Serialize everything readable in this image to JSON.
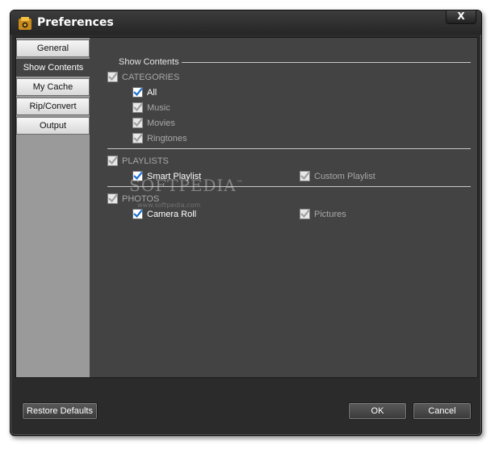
{
  "window": {
    "title": "Preferences",
    "close_label": "X"
  },
  "sidebar": {
    "items": [
      {
        "label": "General",
        "active": false
      },
      {
        "label": "Show Contents",
        "active": true
      },
      {
        "label": "My Cache",
        "active": false
      },
      {
        "label": "Rip/Convert",
        "active": false
      },
      {
        "label": "Output",
        "active": false
      }
    ]
  },
  "main": {
    "section_title": "Show Contents",
    "categories": {
      "label": "CATEGORIES",
      "items": [
        "All",
        "Music",
        "Movies",
        "Ringtones"
      ]
    },
    "playlists": {
      "label": "PLAYLISTS",
      "items": [
        "Smart Playlist",
        "Custom Playlist"
      ]
    },
    "photos": {
      "label": "PHOTOS",
      "items": [
        "Camera Roll",
        "Pictures"
      ]
    }
  },
  "watermark": {
    "text": "SOFTPEDIA",
    "tm": "™",
    "url": "www.softpedia.com"
  },
  "footer": {
    "restore_label": "Restore Defaults",
    "ok_label": "OK",
    "cancel_label": "Cancel"
  },
  "colors": {
    "checkbox_check": "#1e6fd0",
    "disabled_check": "#a0a0a0"
  }
}
